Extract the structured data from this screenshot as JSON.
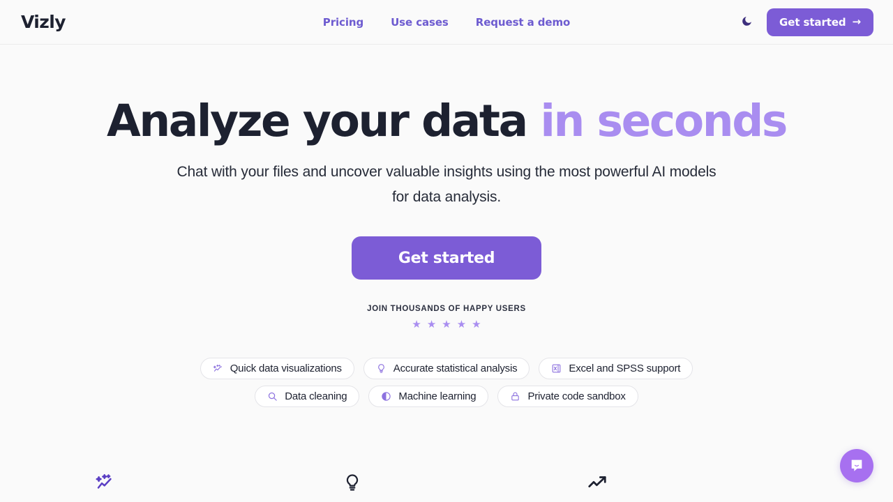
{
  "brand": {
    "logo_text": "Vizly",
    "accent_color": "#7c5cd6",
    "accent_light_color": "#a98df0",
    "text_color": "#1d2130"
  },
  "header": {
    "nav_links": [
      {
        "label": "Pricing",
        "name": "nav-link-pricing"
      },
      {
        "label": "Use cases",
        "name": "nav-link-use-cases"
      },
      {
        "label": "Request a demo",
        "name": "nav-link-request-a-demo"
      }
    ],
    "theme_toggle_icon": "moon-icon",
    "cta_label": "Get started",
    "cta_arrow": "→"
  },
  "hero": {
    "headline_main": "Analyze your data",
    "headline_accent": "in seconds",
    "subhead": "Chat with your files and uncover valuable insights using the most powerful AI models for data analysis.",
    "cta_label": "Get started",
    "social_proof_text": "JOIN THOUSANDS OF HAPPY USERS",
    "star_count": 5,
    "star_glyph": "★",
    "star_color": "#a98df0"
  },
  "features": {
    "row1": [
      {
        "label": "Quick data visualizations",
        "icon": "sparkle-chart-icon"
      },
      {
        "label": "Accurate statistical analysis",
        "icon": "lightbulb-icon"
      },
      {
        "label": "Excel and SPSS support",
        "icon": "excel-file-icon"
      }
    ],
    "row2": [
      {
        "label": "Data cleaning",
        "icon": "search-icon"
      },
      {
        "label": "Machine learning",
        "icon": "contrast-circle-icon"
      },
      {
        "label": "Private code sandbox",
        "icon": "lock-icon"
      }
    ]
  },
  "icon_strip": [
    {
      "icon": "sparkle-chart-icon",
      "color": "#5b3fc4"
    },
    {
      "icon": "lightbulb-icon",
      "color": "#1d2130"
    },
    {
      "icon": "trending-up-icon",
      "color": "#1d2130"
    }
  ],
  "chat_widget": {
    "icon": "chat-bubble-icon",
    "color": "#a770f0"
  }
}
